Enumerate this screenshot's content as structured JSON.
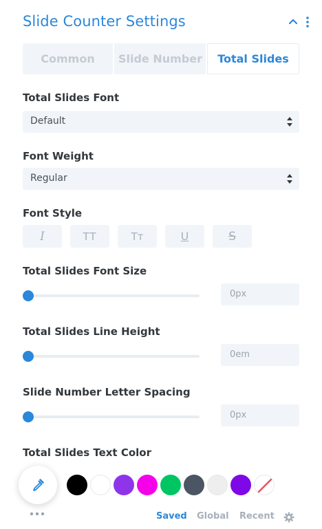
{
  "panel": {
    "title": "Slide Counter Settings"
  },
  "tabs": [
    {
      "label": "Common",
      "active": false
    },
    {
      "label": "Slide Number",
      "active": false
    },
    {
      "label": "Total Slides",
      "active": true
    }
  ],
  "total_slides_font": {
    "label": "Total Slides Font",
    "value": "Default"
  },
  "font_weight": {
    "label": "Font Weight",
    "value": "Regular"
  },
  "font_style": {
    "label": "Font Style",
    "buttons": [
      {
        "name": "italic",
        "glyph": "I"
      },
      {
        "name": "uppercase",
        "glyph": "TT"
      },
      {
        "name": "capitalize",
        "glyph": "Tт"
      },
      {
        "name": "underline",
        "glyph": "U"
      },
      {
        "name": "strikethrough",
        "glyph": "S"
      }
    ]
  },
  "font_size": {
    "label": "Total Slides Font Size",
    "value": "0px",
    "fraction": 0
  },
  "line_height": {
    "label": "Total Slides Line Height",
    "value": "0em",
    "fraction": 0
  },
  "letter_spacing": {
    "label": "Slide Number Letter Spacing",
    "value": "0px",
    "fraction": 0
  },
  "text_color": {
    "label": "Total Slides Text Color",
    "swatches": [
      "#000000",
      "#ffffff",
      "#8f35e9",
      "#f400e9",
      "#00c563",
      "#4b5563",
      "#eeeeee",
      "#7e08e6",
      "none"
    ]
  },
  "footer": {
    "saved": "Saved",
    "global": "Global",
    "recent": "Recent"
  },
  "colors": {
    "accent": "#2b87da",
    "field_bg": "#f1f5f9"
  }
}
